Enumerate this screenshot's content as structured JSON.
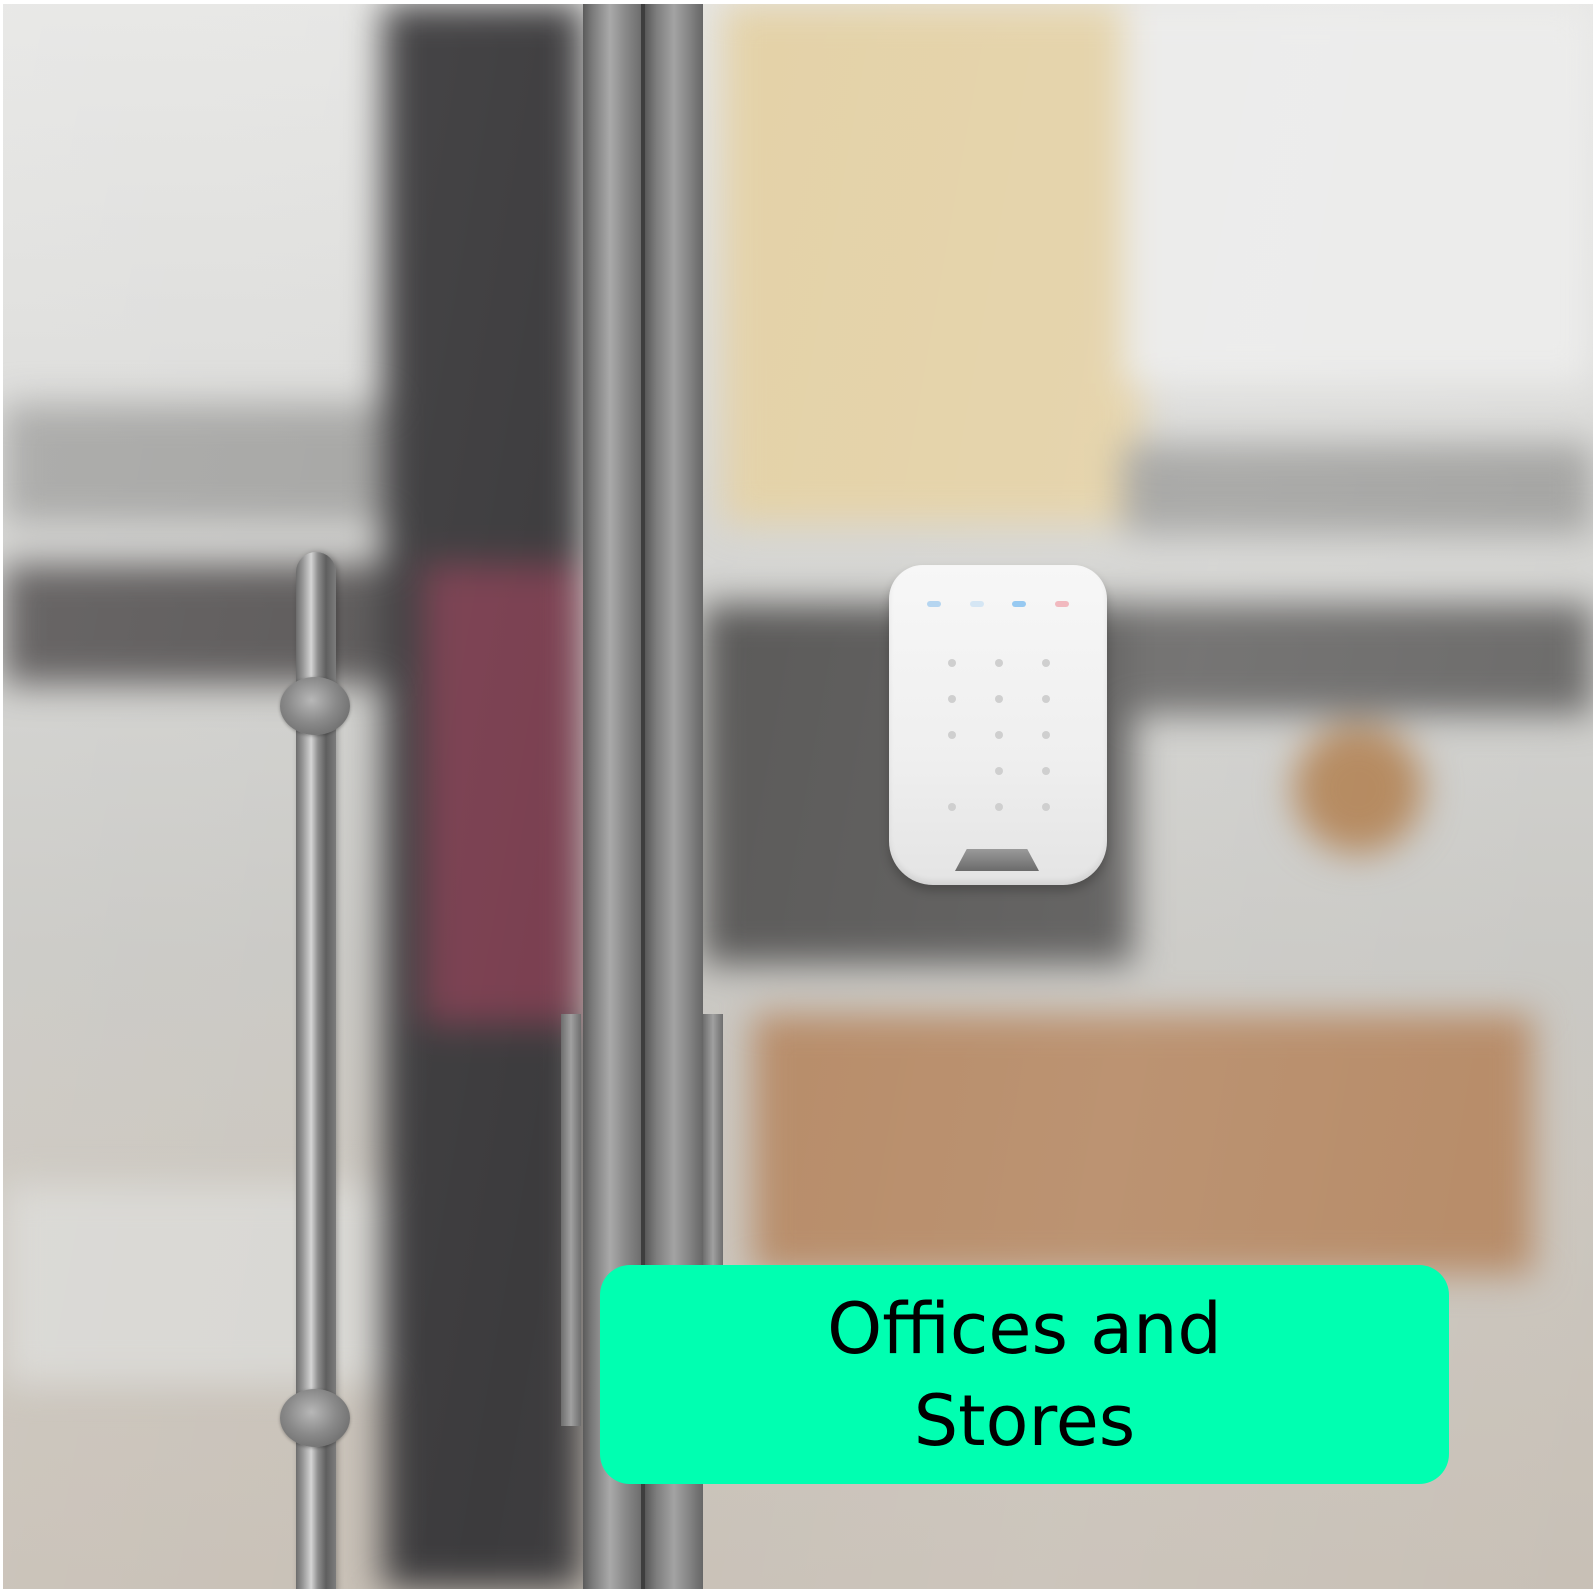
{
  "caption": {
    "line_1": "Offices and",
    "line_2": "Stores",
    "background_color": "#00ffb1",
    "text_color": "#000000"
  },
  "image": {
    "subject": "wall-mounted-security-keypad",
    "door_hardware": "stainless-pull-handle"
  }
}
